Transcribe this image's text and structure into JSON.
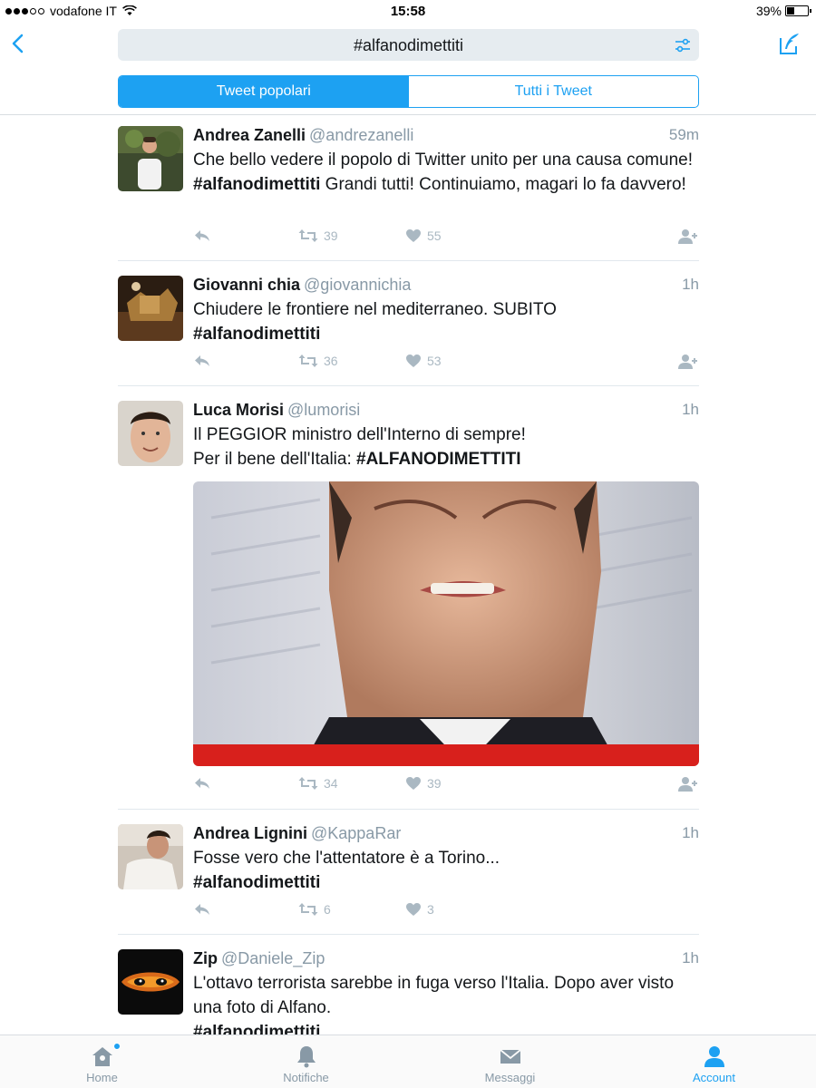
{
  "status_bar": {
    "carrier": "vodafone IT",
    "time": "15:58",
    "battery": "39%"
  },
  "search": {
    "query": "#alfanodimettiti"
  },
  "segments": {
    "popular": "Tweet popolari",
    "all": "Tutti i Tweet"
  },
  "colors": {
    "accent": "#1da1f2",
    "muted": "#8899a6",
    "action_gray": "#aab8c2"
  },
  "tweets": [
    {
      "name": "Andrea Zanelli",
      "handle": "@andrezanelli",
      "time": "59m",
      "text_pre": "Che bello vedere il popolo di Twitter unito per una causa comune! ",
      "hashtag": "#alfanodimettiti",
      "text_post": " Grandi tutti! Continuiamo, magari lo fa davvero!",
      "retweets": "39",
      "likes": "55"
    },
    {
      "name": "Giovanni chia",
      "handle": "@giovannichia",
      "time": "1h",
      "text_pre": "Chiudere le frontiere nel mediterraneo. SUBITO",
      "hashtag": "#alfanodimettiti",
      "text_post": "",
      "retweets": "36",
      "likes": "53"
    },
    {
      "name": "Luca Morisi",
      "handle": "@lumorisi",
      "time": "1h",
      "text_pre": "Il PEGGIOR ministro dell'Interno di sempre!",
      "text_line2": "Per il bene dell'Italia: ",
      "hashtag": "#ALFANODIMETTITI",
      "text_post": "",
      "retweets": "34",
      "likes": "39"
    },
    {
      "name": "Andrea Lignini",
      "handle": "@KappaRar",
      "time": "1h",
      "text_pre": "Fosse vero che l'attentatore è a Torino...",
      "hashtag": "#alfanodimettiti",
      "text_post": "",
      "retweets": "6",
      "likes": "3"
    },
    {
      "name": "Zip",
      "handle": "@Daniele_Zip",
      "time": "1h",
      "text_pre": "L'ottavo terrorista sarebbe in fuga verso l'Italia. Dopo aver visto una foto di Alfano.",
      "hashtag": "#alfanodimettiti",
      "text_post": ""
    }
  ],
  "tabbar": {
    "home": "Home",
    "notifications": "Notifiche",
    "messages": "Messaggi",
    "account": "Account"
  }
}
